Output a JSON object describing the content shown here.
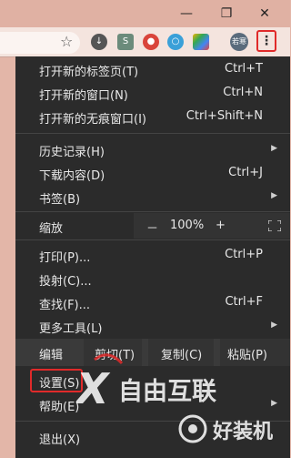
{
  "window": {
    "restore_icon": "restore-icon",
    "close_icon": "close-icon"
  },
  "toolbar": {
    "avatar_text": "若寒",
    "kebab_glyph": "⋮"
  },
  "menu": {
    "group1": [
      {
        "label": "打开新的标签页(T)",
        "shortcut": "Ctrl+T"
      },
      {
        "label": "打开新的窗口(N)",
        "shortcut": "Ctrl+N"
      },
      {
        "label": "打开新的无痕窗口(I)",
        "shortcut": "Ctrl+Shift+N"
      }
    ],
    "group2": [
      {
        "label": "历史记录(H)",
        "shortcut": ""
      },
      {
        "label": "下载内容(D)",
        "shortcut": "Ctrl+J"
      },
      {
        "label": "书签(B)",
        "shortcut": ""
      }
    ],
    "zoom": {
      "label": "缩放",
      "minus": "－",
      "value": "100%",
      "plus": "+"
    },
    "group3": [
      {
        "label": "打印(P)...",
        "shortcut": "Ctrl+P"
      },
      {
        "label": "投射(C)...",
        "shortcut": ""
      },
      {
        "label": "查找(F)...",
        "shortcut": "Ctrl+F"
      },
      {
        "label": "更多工具(L)",
        "shortcut": ""
      }
    ],
    "edit": {
      "label": "编辑",
      "cut": "剪切(T)",
      "copy": "复制(C)",
      "paste": "粘贴(P)"
    },
    "group4": [
      {
        "label": "设置(S)"
      },
      {
        "label": "帮助(E)"
      }
    ],
    "exit": {
      "label": "退出(X)"
    }
  },
  "watermark": {
    "text": "自由互联"
  },
  "colors": {
    "menu_bg": "#2b2b2b",
    "highlight": "#e02a2a",
    "titlebar": "#e0b1a3"
  }
}
